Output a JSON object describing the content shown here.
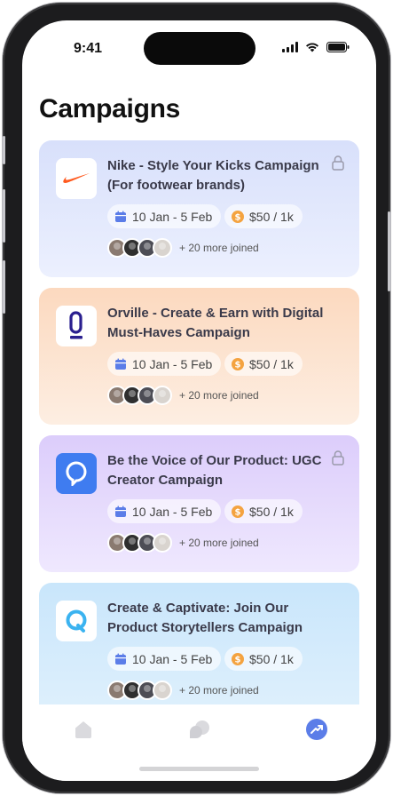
{
  "status_bar": {
    "time": "9:41"
  },
  "page": {
    "title": "Campaigns"
  },
  "campaigns": [
    {
      "title": "Nike - Style Your Kicks Campaign (For footwear brands)",
      "dates": "10 Jan - 5 Feb",
      "price": "$50 / 1k",
      "joined": "+ 20 more joined",
      "locked": true,
      "logo": "nike-logo"
    },
    {
      "title": "Orville - Create & Earn with Digital Must-Haves Campaign",
      "dates": "10 Jan - 5 Feb",
      "price": "$50 / 1k",
      "joined": "+ 20 more joined",
      "locked": false,
      "logo": "orville-logo"
    },
    {
      "title": "Be the Voice of Our Product: UGC Creator Campaign",
      "dates": "10 Jan - 5 Feb",
      "price": "$50 / 1k",
      "joined": "+ 20 more joined",
      "locked": true,
      "logo": "chat-pin-logo"
    },
    {
      "title": "Create & Captivate: Join Our Product Storytellers Campaign",
      "dates": "10 Jan - 5 Feb",
      "price": "$50 / 1k",
      "joined": "+ 20 more joined",
      "locked": false,
      "logo": "q-logo"
    }
  ],
  "tabbar": {
    "items": [
      "home-icon",
      "chat-bubbles-icon",
      "growth-arrow-icon"
    ],
    "active": "growth-arrow-icon"
  },
  "colors": {
    "accent": "#5b7de8",
    "coin": "#f4a340",
    "nike_swoosh": "#ff5a1f",
    "orville": "#2a1f8f",
    "chat_pin_bg": "#3f7cf0",
    "q_logo": "#3bb3f0"
  }
}
